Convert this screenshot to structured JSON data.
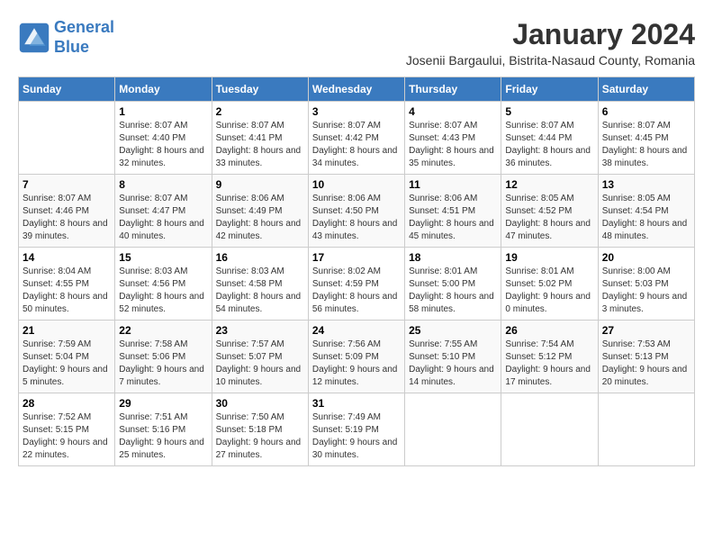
{
  "logo": {
    "line1": "General",
    "line2": "Blue"
  },
  "title": "January 2024",
  "subtitle": "Josenii Bargaului, Bistrita-Nasaud County, Romania",
  "days_of_week": [
    "Sunday",
    "Monday",
    "Tuesday",
    "Wednesday",
    "Thursday",
    "Friday",
    "Saturday"
  ],
  "weeks": [
    [
      {
        "day": "",
        "info": ""
      },
      {
        "day": "1",
        "info": "Sunrise: 8:07 AM\nSunset: 4:40 PM\nDaylight: 8 hours\nand 32 minutes."
      },
      {
        "day": "2",
        "info": "Sunrise: 8:07 AM\nSunset: 4:41 PM\nDaylight: 8 hours\nand 33 minutes."
      },
      {
        "day": "3",
        "info": "Sunrise: 8:07 AM\nSunset: 4:42 PM\nDaylight: 8 hours\nand 34 minutes."
      },
      {
        "day": "4",
        "info": "Sunrise: 8:07 AM\nSunset: 4:43 PM\nDaylight: 8 hours\nand 35 minutes."
      },
      {
        "day": "5",
        "info": "Sunrise: 8:07 AM\nSunset: 4:44 PM\nDaylight: 8 hours\nand 36 minutes."
      },
      {
        "day": "6",
        "info": "Sunrise: 8:07 AM\nSunset: 4:45 PM\nDaylight: 8 hours\nand 38 minutes."
      }
    ],
    [
      {
        "day": "7",
        "info": "Sunrise: 8:07 AM\nSunset: 4:46 PM\nDaylight: 8 hours\nand 39 minutes."
      },
      {
        "day": "8",
        "info": "Sunrise: 8:07 AM\nSunset: 4:47 PM\nDaylight: 8 hours\nand 40 minutes."
      },
      {
        "day": "9",
        "info": "Sunrise: 8:06 AM\nSunset: 4:49 PM\nDaylight: 8 hours\nand 42 minutes."
      },
      {
        "day": "10",
        "info": "Sunrise: 8:06 AM\nSunset: 4:50 PM\nDaylight: 8 hours\nand 43 minutes."
      },
      {
        "day": "11",
        "info": "Sunrise: 8:06 AM\nSunset: 4:51 PM\nDaylight: 8 hours\nand 45 minutes."
      },
      {
        "day": "12",
        "info": "Sunrise: 8:05 AM\nSunset: 4:52 PM\nDaylight: 8 hours\nand 47 minutes."
      },
      {
        "day": "13",
        "info": "Sunrise: 8:05 AM\nSunset: 4:54 PM\nDaylight: 8 hours\nand 48 minutes."
      }
    ],
    [
      {
        "day": "14",
        "info": "Sunrise: 8:04 AM\nSunset: 4:55 PM\nDaylight: 8 hours\nand 50 minutes."
      },
      {
        "day": "15",
        "info": "Sunrise: 8:03 AM\nSunset: 4:56 PM\nDaylight: 8 hours\nand 52 minutes."
      },
      {
        "day": "16",
        "info": "Sunrise: 8:03 AM\nSunset: 4:58 PM\nDaylight: 8 hours\nand 54 minutes."
      },
      {
        "day": "17",
        "info": "Sunrise: 8:02 AM\nSunset: 4:59 PM\nDaylight: 8 hours\nand 56 minutes."
      },
      {
        "day": "18",
        "info": "Sunrise: 8:01 AM\nSunset: 5:00 PM\nDaylight: 8 hours\nand 58 minutes."
      },
      {
        "day": "19",
        "info": "Sunrise: 8:01 AM\nSunset: 5:02 PM\nDaylight: 9 hours\nand 0 minutes."
      },
      {
        "day": "20",
        "info": "Sunrise: 8:00 AM\nSunset: 5:03 PM\nDaylight: 9 hours\nand 3 minutes."
      }
    ],
    [
      {
        "day": "21",
        "info": "Sunrise: 7:59 AM\nSunset: 5:04 PM\nDaylight: 9 hours\nand 5 minutes."
      },
      {
        "day": "22",
        "info": "Sunrise: 7:58 AM\nSunset: 5:06 PM\nDaylight: 9 hours\nand 7 minutes."
      },
      {
        "day": "23",
        "info": "Sunrise: 7:57 AM\nSunset: 5:07 PM\nDaylight: 9 hours\nand 10 minutes."
      },
      {
        "day": "24",
        "info": "Sunrise: 7:56 AM\nSunset: 5:09 PM\nDaylight: 9 hours\nand 12 minutes."
      },
      {
        "day": "25",
        "info": "Sunrise: 7:55 AM\nSunset: 5:10 PM\nDaylight: 9 hours\nand 14 minutes."
      },
      {
        "day": "26",
        "info": "Sunrise: 7:54 AM\nSunset: 5:12 PM\nDaylight: 9 hours\nand 17 minutes."
      },
      {
        "day": "27",
        "info": "Sunrise: 7:53 AM\nSunset: 5:13 PM\nDaylight: 9 hours\nand 20 minutes."
      }
    ],
    [
      {
        "day": "28",
        "info": "Sunrise: 7:52 AM\nSunset: 5:15 PM\nDaylight: 9 hours\nand 22 minutes."
      },
      {
        "day": "29",
        "info": "Sunrise: 7:51 AM\nSunset: 5:16 PM\nDaylight: 9 hours\nand 25 minutes."
      },
      {
        "day": "30",
        "info": "Sunrise: 7:50 AM\nSunset: 5:18 PM\nDaylight: 9 hours\nand 27 minutes."
      },
      {
        "day": "31",
        "info": "Sunrise: 7:49 AM\nSunset: 5:19 PM\nDaylight: 9 hours\nand 30 minutes."
      },
      {
        "day": "",
        "info": ""
      },
      {
        "day": "",
        "info": ""
      },
      {
        "day": "",
        "info": ""
      }
    ]
  ]
}
